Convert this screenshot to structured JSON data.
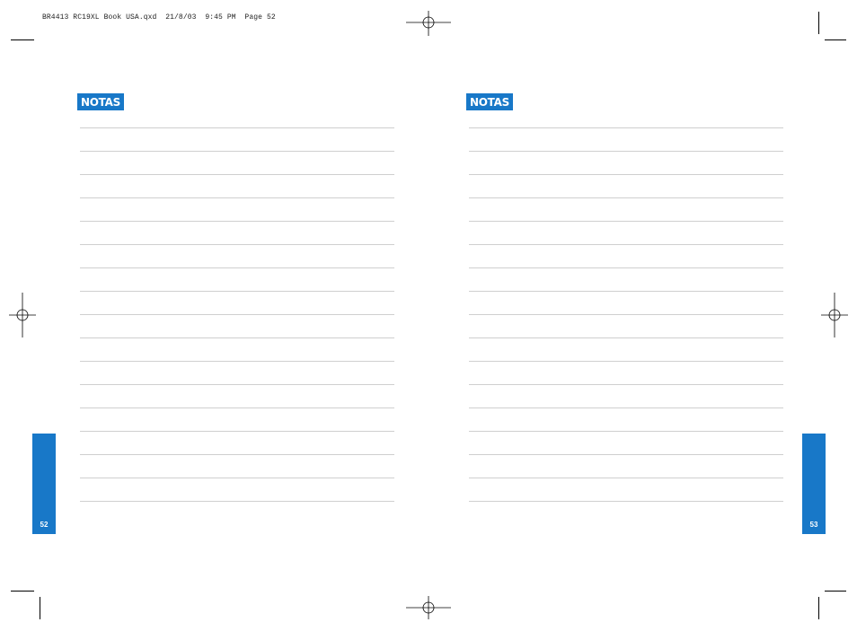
{
  "slug_line": "BR4413 RC19XL Book USA.qxd  21/8/03  9:45 PM  Page 52",
  "left_page": {
    "heading": "NOTAS",
    "page_number": "52",
    "line_count": 17
  },
  "right_page": {
    "heading": "NOTAS",
    "page_number": "53",
    "line_count": 17
  },
  "colors": {
    "accent": "#1878c8",
    "rule": "#cfcfcf"
  }
}
